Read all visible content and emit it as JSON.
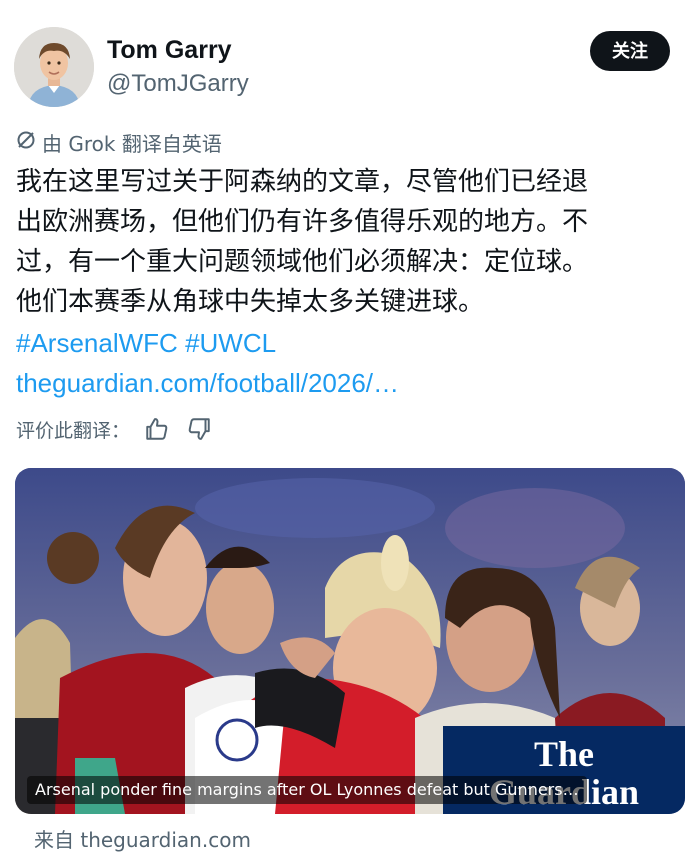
{
  "author": {
    "display_name": "Tom Garry",
    "handle": "@TomJGarry",
    "follow_label": "关注"
  },
  "translation": {
    "label": "由 Grok 翻译自英语",
    "rate_label": "评价此翻译："
  },
  "tweet": {
    "text_lines": [
      "我在这里写过关于阿森纳的文章，尽管他们已经退",
      "出欧洲赛场，但他们仍有许多值得乐观的地方。不",
      "过，有一个重大问题领域他们必须解决：定位球。",
      "他们本赛季从角球中失掉太多关键进球。"
    ],
    "hashtag_1": "#ArsenalWFC",
    "hashtag_2": "#UWCL",
    "link": "theguardian.com/football/2026/…"
  },
  "card": {
    "caption": "Arsenal ponder fine margins after OL Lyonnes defeat but Gunners…",
    "logo_line_1": "The",
    "logo_line_2": "Guardian",
    "source_label": "来自 theguardian.com"
  },
  "icons": {
    "translate": "translate-slash-icon",
    "thumb_up": "thumbs-up-icon",
    "thumb_down": "thumbs-down-icon"
  },
  "colors": {
    "link": "#1d9bf0",
    "secondary_text": "#536471",
    "follow_bg": "#0f1419",
    "guardian_blue": "#052962"
  }
}
